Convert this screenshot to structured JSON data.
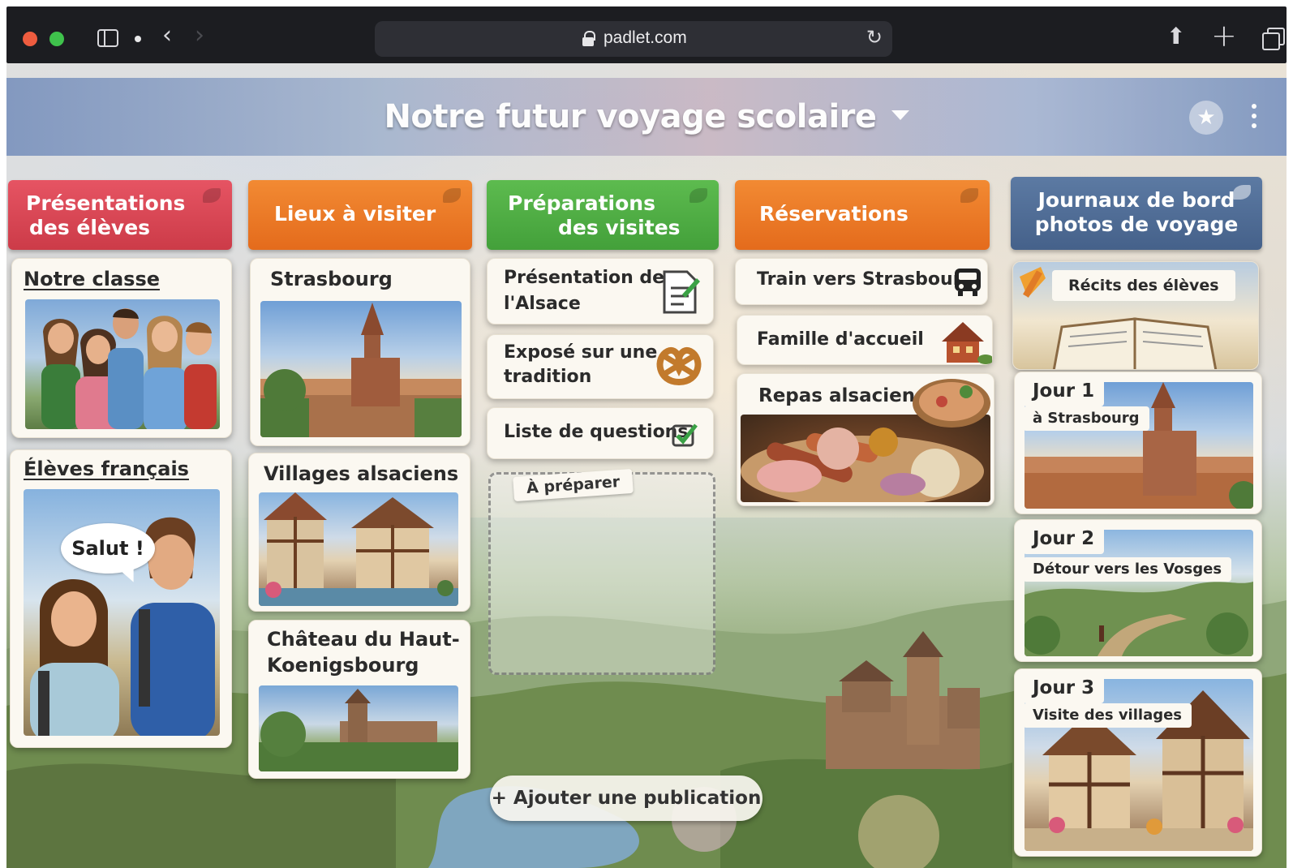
{
  "browser": {
    "url": "padlet.com"
  },
  "board": {
    "title": "Notre futur voyage scolaire"
  },
  "columns": [
    {
      "title_line1": "Présentations",
      "title_line2": "des élèves"
    },
    {
      "title_line1": "Lieux à visiter",
      "title_line2": ""
    },
    {
      "title_line1": "Préparations",
      "title_line2": "des visites"
    },
    {
      "title_line1": "Réservations",
      "title_line2": ""
    },
    {
      "title_line1": "Journaux de bord",
      "title_line2": "photos de voyage"
    }
  ],
  "col1": {
    "card1_title": "Notre classe",
    "card2_title": "Élèves français",
    "speech_bubble": "Salut !"
  },
  "col2": {
    "card1_title": "Strasbourg",
    "card2_title": "Villages alsaciens",
    "card3_title_line1": "Château du Haut-",
    "card3_title_line2": "Koenigsbourg"
  },
  "col3": {
    "item1_line1": "Présentation de",
    "item1_line2": "l'Alsace",
    "item2_line1": "Exposé sur une",
    "item2_line2": "tradition",
    "item3": "Liste de questions",
    "dropzone_tag": "À préparer"
  },
  "col4": {
    "item1": "Train vers Strasbourg",
    "item2": "Famille d'accueil",
    "item3": "Repas alsaciens"
  },
  "col5": {
    "banner": "Récits des élèves",
    "days": [
      {
        "title": "Jour 1",
        "subtitle": "à Strasbourg"
      },
      {
        "title": "Jour 2",
        "subtitle": "Détour vers les Vosges"
      },
      {
        "title": "Jour 3",
        "subtitle": "Visite des villages"
      }
    ]
  },
  "add_post_label": "+ Ajouter une publication"
}
